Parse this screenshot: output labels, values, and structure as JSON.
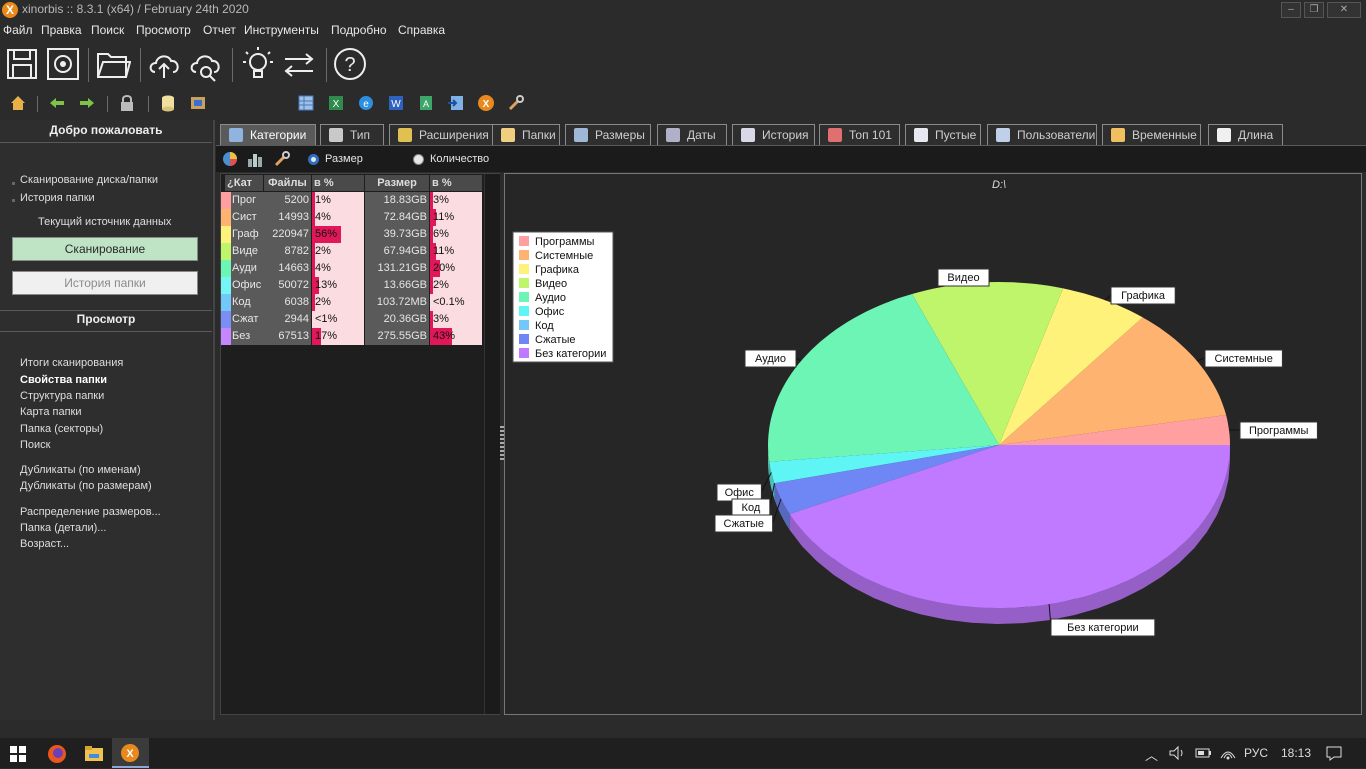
{
  "window": {
    "title": "xinorbis :: 8.3.1 (x64) / February 24th 2020",
    "min": "–",
    "max": "❐",
    "close": "✕"
  },
  "menu": [
    "Файл",
    "Правка",
    "Поиск",
    "Просмотр",
    "Отчет",
    "Инструменты",
    "Подробно",
    "Справка"
  ],
  "toolbar_big": [
    "save-icon",
    "settings-icon",
    "folder-open-icon",
    "cloud-upload-icon",
    "cloud-search-icon",
    "lightbulb-icon",
    "swap-icon",
    "help-icon"
  ],
  "toolbar_small": [
    "home-icon",
    "back-icon",
    "forward-icon",
    "lock-icon",
    "database-icon",
    "export-icon",
    "table-icon",
    "excel-icon",
    "ie-icon",
    "word-icon",
    "xml-icon",
    "import-icon",
    "xinorbis-icon",
    "tools-icon"
  ],
  "sidebar": {
    "welcome": "Добро пожаловать",
    "scan_links": [
      "Сканирование диска/папки",
      "История папки"
    ],
    "current_source": "Текущий источник данных",
    "scan_button": "Сканирование",
    "history_button": "История папки",
    "view_header": "Просмотр",
    "view_links": [
      "Итоги сканирования",
      "Свойства папки",
      "Структура папки",
      "Карта папки",
      "Папка (секторы)",
      "Поиск"
    ],
    "dup_links": [
      "Дубликаты (по именам)",
      "Дубликаты (по размерам)"
    ],
    "more_links": [
      "Распределение размеров...",
      "Папка (детали)...",
      "Возраст..."
    ]
  },
  "tabs": [
    {
      "label": "Категории",
      "icon": "categories-icon"
    },
    {
      "label": "Тип",
      "icon": "type-icon"
    },
    {
      "label": "Расширения",
      "icon": "extensions-icon"
    },
    {
      "label": "Папки",
      "icon": "folders-icon"
    },
    {
      "label": "Размеры",
      "icon": "sizes-icon"
    },
    {
      "label": "Даты",
      "icon": "dates-icon"
    },
    {
      "label": "История",
      "icon": "history-icon"
    },
    {
      "label": "Топ 101",
      "icon": "top101-icon"
    },
    {
      "label": "Пустые",
      "icon": "empty-icon"
    },
    {
      "label": "Пользователи",
      "icon": "users-icon"
    },
    {
      "label": "Временные",
      "icon": "temporary-icon"
    },
    {
      "label": "Длина",
      "icon": "length-icon"
    }
  ],
  "subbar": {
    "radio_size": "Размер",
    "radio_count": "Количество"
  },
  "table": {
    "headers": [
      "¿Кат",
      "Файлы",
      "в %",
      "Размер",
      "в %"
    ],
    "rows": [
      {
        "cat": "Прог",
        "files": "5200",
        "fpct": "1%",
        "fpv": 1,
        "size": "18.83GB",
        "spct": "3%",
        "spv": 3,
        "color": "#ff9f9f"
      },
      {
        "cat": "Сист",
        "files": "14993",
        "fpct": "4%",
        "fpv": 4,
        "size": "72.84GB",
        "spct": "11%",
        "spv": 11,
        "color": "#ffb370"
      },
      {
        "cat": "Граф",
        "files": "220947",
        "fpct": "56%",
        "fpv": 56,
        "size": "39.73GB",
        "spct": "6%",
        "spv": 6,
        "color": "#fff27a"
      },
      {
        "cat": "Виде",
        "files": "8782",
        "fpct": "2%",
        "fpv": 2,
        "size": "67.94GB",
        "spct": "11%",
        "spv": 11,
        "color": "#bff56a"
      },
      {
        "cat": "Ауди",
        "files": "14663",
        "fpct": "4%",
        "fpv": 4,
        "size": "131.21GB",
        "spct": "20%",
        "spv": 20,
        "color": "#6cf5b4"
      },
      {
        "cat": "Офис",
        "files": "50072",
        "fpct": "13%",
        "fpv": 13,
        "size": "13.66GB",
        "spct": "2%",
        "spv": 2,
        "color": "#74f6f4"
      },
      {
        "cat": "Код",
        "files": "6038",
        "fpct": "2%",
        "fpv": 2,
        "size": "103.72MB",
        "spct": "<0.1%",
        "spv": 0,
        "color": "#72c8f8"
      },
      {
        "cat": "Сжат",
        "files": "2944",
        "fpct": "<1%",
        "fpv": 0,
        "size": "20.36GB",
        "spct": "3%",
        "spv": 3,
        "color": "#7a8ef5"
      },
      {
        "cat": "Без",
        "files": "67513",
        "fpct": "17%",
        "fpv": 17,
        "size": "275.55GB",
        "spct": "43%",
        "spv": 43,
        "color": "#c487ff"
      }
    ]
  },
  "chart_data": {
    "type": "pie",
    "title": "D:\\",
    "legend_position": "top-left",
    "slices": [
      {
        "label": "Программы",
        "value": 18.83,
        "color": "#ff9f9f"
      },
      {
        "label": "Системные",
        "value": 72.84,
        "color": "#ffb370"
      },
      {
        "label": "Графика",
        "value": 39.73,
        "color": "#fff27a"
      },
      {
        "label": "Видео",
        "value": 67.94,
        "color": "#bff56a"
      },
      {
        "label": "Аудио",
        "value": 131.21,
        "color": "#6cf5b4"
      },
      {
        "label": "Офис",
        "value": 13.66,
        "color": "#5ff5f4"
      },
      {
        "label": "Код",
        "value": 0.1,
        "color": "#72c8f8"
      },
      {
        "label": "Сжатые",
        "value": 20.36,
        "color": "#6f86f5"
      },
      {
        "label": "Без категории",
        "value": 275.55,
        "color": "#c07aff"
      }
    ]
  },
  "taskbar": {
    "lang": "РУС",
    "time": "18:13"
  }
}
